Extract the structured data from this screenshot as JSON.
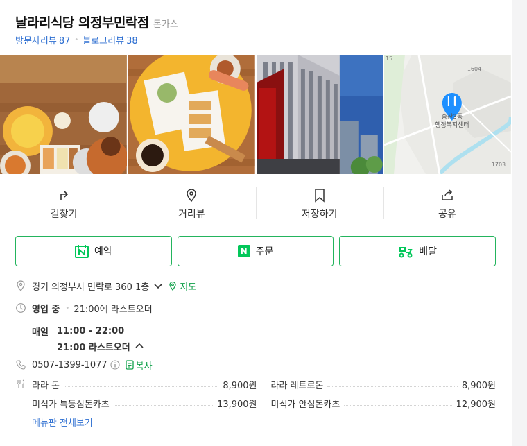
{
  "header": {
    "title": "날라리식당 의정부민락점",
    "category": "돈가스",
    "visitor_reviews_label": "방문자리뷰",
    "visitor_reviews_count": "87",
    "blog_reviews_label": "블로그리뷰",
    "blog_reviews_count": "38"
  },
  "map_thumb": {
    "label_line1": "송산3동",
    "label_line2": "행정복지센터",
    "num1": "1604",
    "num2": "1703",
    "num3": "15"
  },
  "actions": [
    {
      "label": "길찾기",
      "icon": "directions-icon"
    },
    {
      "label": "거리뷰",
      "icon": "street-view-icon"
    },
    {
      "label": "저장하기",
      "icon": "bookmark-icon"
    },
    {
      "label": "공유",
      "icon": "share-icon"
    }
  ],
  "buttons": {
    "reserve": "예약",
    "order": "주문",
    "delivery": "배달"
  },
  "info": {
    "address": "경기 의정부시 민락로 360 1층",
    "map_link": "지도",
    "status": "영업 중",
    "last_order_note": "21:00에 라스트오더",
    "day": "매일",
    "hours": "11:00 - 22:00",
    "last_order": "21:00 라스트오더",
    "phone": "0507-1399-1077",
    "copy": "복사"
  },
  "menu": {
    "items": [
      {
        "name": "라라 돈",
        "price": "8,900원"
      },
      {
        "name": "라라 레트로돈",
        "price": "8,900원"
      },
      {
        "name": "미식가 특등심돈카츠",
        "price": "13,900원"
      },
      {
        "name": "미식가 안심돈카츠",
        "price": "12,900원"
      }
    ],
    "more": "메뉴판 전체보기"
  },
  "colors": {
    "accent_green": "#03c75a",
    "link_blue": "#2c6ed1",
    "map_pin": "#1e90ff"
  }
}
